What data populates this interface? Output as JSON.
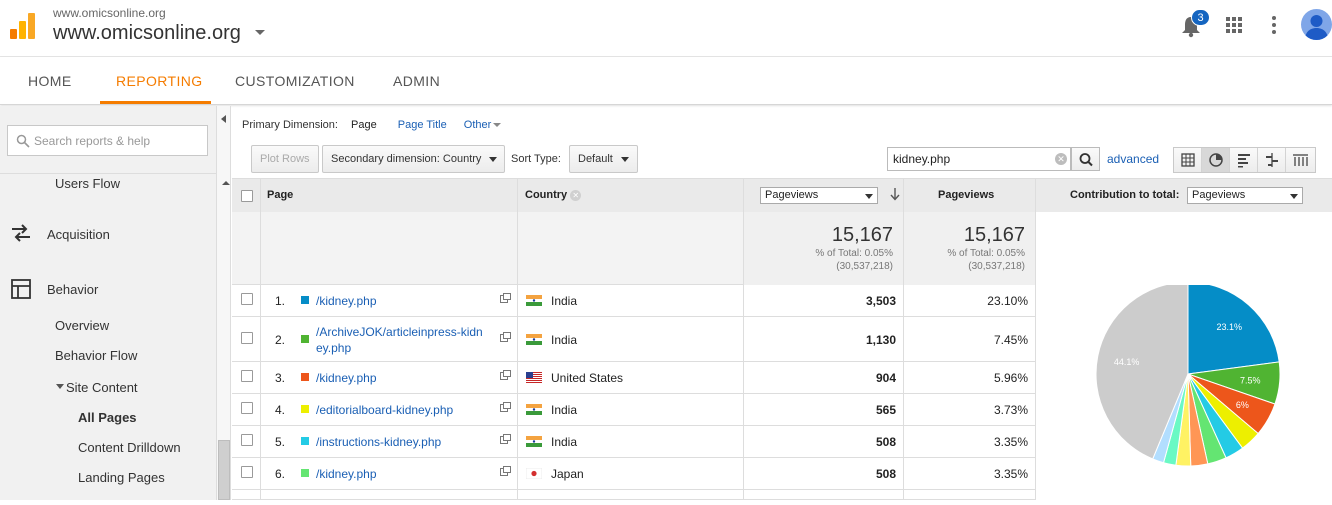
{
  "header": {
    "site_small": "www.omicsonline.org",
    "site_title": "www.omicsonline.org",
    "notification_count": "3"
  },
  "nav": {
    "tabs": [
      {
        "label": "HOME",
        "active": false
      },
      {
        "label": "REPORTING",
        "active": true
      },
      {
        "label": "CUSTOMIZATION",
        "active": false
      },
      {
        "label": "ADMIN",
        "active": false
      }
    ]
  },
  "sidebar": {
    "search_placeholder": "Search reports & help",
    "users_flow": "Users Flow",
    "acquisition": "Acquisition",
    "behavior": "Behavior",
    "overview": "Overview",
    "behavior_flow": "Behavior Flow",
    "site_content": "Site Content",
    "all_pages": "All Pages",
    "content_drilldown": "Content Drilldown",
    "landing_pages": "Landing Pages"
  },
  "toolbar": {
    "primary_dimension_label": "Primary Dimension:",
    "dim_page": "Page",
    "dim_page_title": "Page Title",
    "dim_other": "Other",
    "plot_rows": "Plot Rows",
    "secondary_dimension": "Secondary dimension: Country",
    "sort_type_label": "Sort Type:",
    "sort_type_value": "Default",
    "filter_value": "kidney.php",
    "advanced": "advanced"
  },
  "table": {
    "headers": {
      "page": "Page",
      "country": "Country",
      "metric_select": "Pageviews",
      "pageviews": "Pageviews",
      "contribution_label": "Contribution to total:",
      "contribution_select": "Pageviews"
    },
    "totals": {
      "value1": "15,167",
      "pct1": "% of Total: 0.05%",
      "abs1": "(30,537,218)",
      "value2": "15,167",
      "pct2": "% of Total: 0.05%",
      "abs2": "(30,537,218)"
    },
    "rows": [
      {
        "index": "1.",
        "page": "/kidney.php",
        "country": "India",
        "pageviews": "3,503",
        "percent": "23.10%",
        "color": "#058dc7",
        "flag": "india"
      },
      {
        "index": "2.",
        "page": "/ArchiveJOK/articleinpress-kidney.php",
        "page_line1": "/ArchiveJOK/articleinpress-kidn",
        "page_line2": "ey.php",
        "country": "India",
        "pageviews": "1,130",
        "percent": "7.45%",
        "color": "#50b432",
        "flag": "india"
      },
      {
        "index": "3.",
        "page": "/kidney.php",
        "country": "United States",
        "pageviews": "904",
        "percent": "5.96%",
        "color": "#ed561b",
        "flag": "usa"
      },
      {
        "index": "4.",
        "page": "/editorialboard-kidney.php",
        "country": "India",
        "pageviews": "565",
        "percent": "3.73%",
        "color": "#edef00",
        "flag": "india"
      },
      {
        "index": "5.",
        "page": "/instructions-kidney.php",
        "country": "India",
        "pageviews": "508",
        "percent": "3.35%",
        "color": "#24cbe5",
        "flag": "india"
      },
      {
        "index": "6.",
        "page": "/kidney.php",
        "country": "Japan",
        "pageviews": "508",
        "percent": "3.35%",
        "color": "#64e572",
        "flag": "japan"
      }
    ]
  },
  "chart_data": {
    "type": "pie",
    "slices": [
      {
        "label": "23.1%",
        "value": 23.1,
        "color": "#058dc7"
      },
      {
        "label": "7.5%",
        "value": 7.45,
        "color": "#50b432"
      },
      {
        "label": "6%",
        "value": 5.96,
        "color": "#ed561b"
      },
      {
        "label": "",
        "value": 3.73,
        "color": "#edef00"
      },
      {
        "label": "",
        "value": 3.35,
        "color": "#24cbe5"
      },
      {
        "label": "",
        "value": 3.35,
        "color": "#64e572"
      },
      {
        "label": "",
        "value": 3.0,
        "color": "#ff9655"
      },
      {
        "label": "",
        "value": 2.6,
        "color": "#fff263"
      },
      {
        "label": "",
        "value": 2.2,
        "color": "#6af9c4"
      },
      {
        "label": "",
        "value": 2.0,
        "color": "#b2deff"
      },
      {
        "label": "44.1%",
        "value": 44.1,
        "color": "#cccccc"
      }
    ]
  }
}
